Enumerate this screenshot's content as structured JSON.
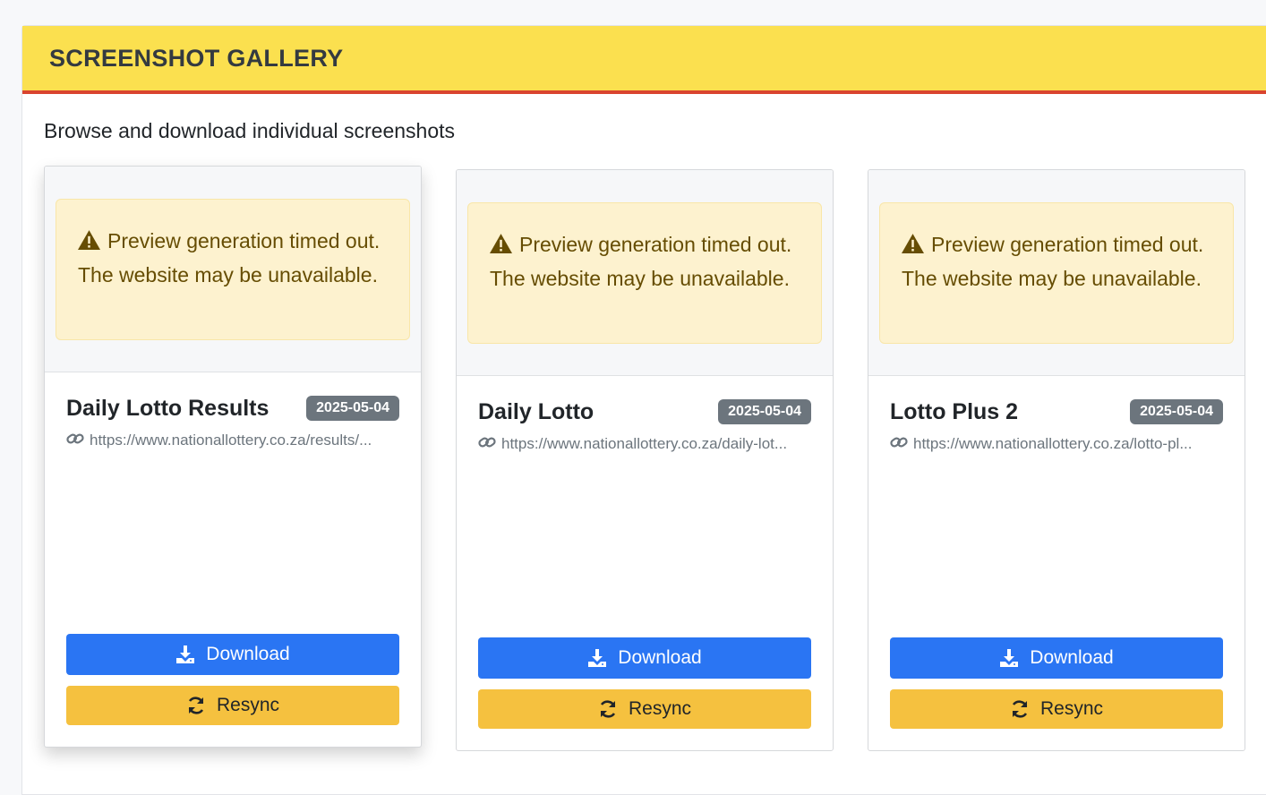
{
  "gallery": {
    "title": "SCREENSHOT GALLERY",
    "subtitle": "Browse and download individual screenshots"
  },
  "colors": {
    "header_bg": "#fbe04f",
    "header_border": "#d9442f",
    "download_button": "#2a75f3",
    "resync_button": "#f5c13f",
    "badge": "#6c757d",
    "warning_bg": "#fdf2cf"
  },
  "cards": [
    {
      "warning_text": "Preview generation timed out. The website may be unavailable.",
      "warning_icon": "warning-triangle-icon",
      "title": "Daily Lotto Results",
      "date": "2025-05-04",
      "url": "https://www.nationallottery.co.za/results/...",
      "download_label": "Download",
      "resync_label": "Resync"
    },
    {
      "warning_text": "Preview generation timed out. The website may be unavailable.",
      "warning_icon": "warning-triangle-icon",
      "title": "Daily Lotto",
      "date": "2025-05-04",
      "url": "https://www.nationallottery.co.za/daily-lot...",
      "download_label": "Download",
      "resync_label": "Resync"
    },
    {
      "warning_text": "Preview generation timed out. The website may be unavailable.",
      "warning_icon": "warning-triangle-icon",
      "title": "Lotto Plus 2",
      "date": "2025-05-04",
      "url": "https://www.nationallottery.co.za/lotto-pl...",
      "download_label": "Download",
      "resync_label": "Resync"
    }
  ]
}
